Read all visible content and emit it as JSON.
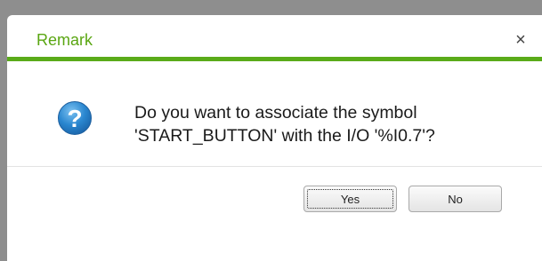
{
  "dialog": {
    "title": "Remark",
    "close_label": "×",
    "message_lines": [
      "Do you want to associate the symbol",
      "'START_BUTTON' with the I/O '%I0.7'?"
    ],
    "icon": "question-icon",
    "buttons": {
      "yes_label": "Yes",
      "no_label": "No"
    }
  },
  "colors": {
    "accent": "#5aab19",
    "title_text": "#5aa612",
    "icon_blue": "#2a87d0",
    "backdrop": "#8e8e8e"
  }
}
